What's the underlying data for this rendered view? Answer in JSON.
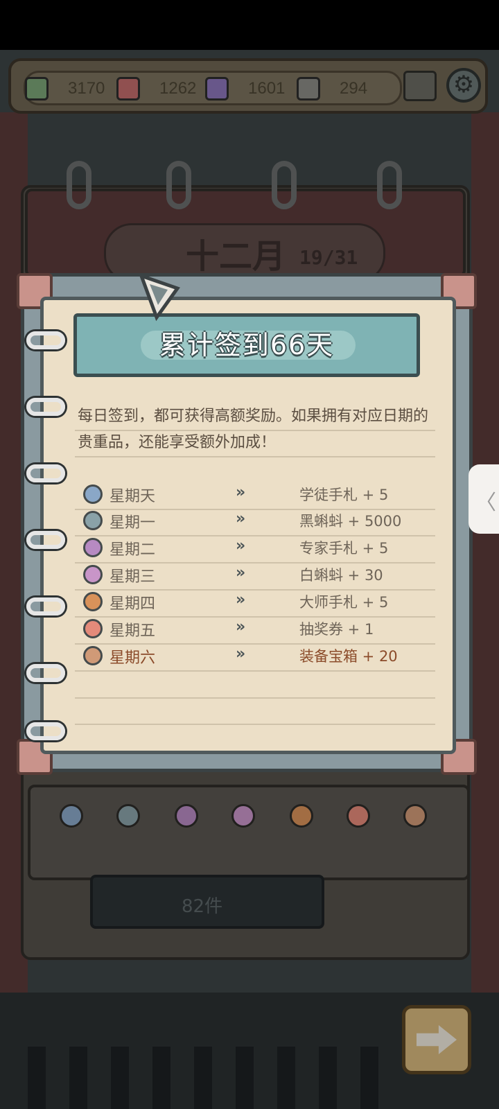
{
  "resources": [
    {
      "name": "green-cube",
      "value": "3170",
      "color": "#7aa376"
    },
    {
      "name": "red-cube",
      "value": "1262",
      "color": "#c16b6b"
    },
    {
      "name": "purple-cube",
      "value": "1601",
      "color": "#8b75b8"
    },
    {
      "name": "gray-cube",
      "value": "294",
      "color": "#8a8a84"
    }
  ],
  "calendar": {
    "month": "十二月",
    "day_progress": "19/31"
  },
  "popup": {
    "title": "累计签到66天",
    "description": "每日签到，都可获得高额奖励。如果拥有对应日期的贵重品，还能享受额外加成！",
    "rows": [
      {
        "day": "星期天",
        "chev": "»",
        "reward": "学徒手札 + 5",
        "icon_color": "#8aa7c7"
      },
      {
        "day": "星期一",
        "chev": "»",
        "reward": "黑蝌蚪 + 5000",
        "icon_color": "#8aa2a8"
      },
      {
        "day": "星期二",
        "chev": "»",
        "reward": "专家手札 + 5",
        "icon_color": "#b78ac2"
      },
      {
        "day": "星期三",
        "chev": "»",
        "reward": "白蝌蚪 + 30",
        "icon_color": "#c895c8"
      },
      {
        "day": "星期四",
        "chev": "»",
        "reward": "大师手札 + 5",
        "icon_color": "#d9925a"
      },
      {
        "day": "星期五",
        "chev": "»",
        "reward": "抽奖券 + 1",
        "icon_color": "#e48a7a"
      },
      {
        "day": "星期六",
        "chev": "»",
        "reward": "装备宝箱 + 20",
        "icon_color": "#d09a77"
      }
    ]
  },
  "background": {
    "banner_count": "82件"
  },
  "side_tab": "〈"
}
